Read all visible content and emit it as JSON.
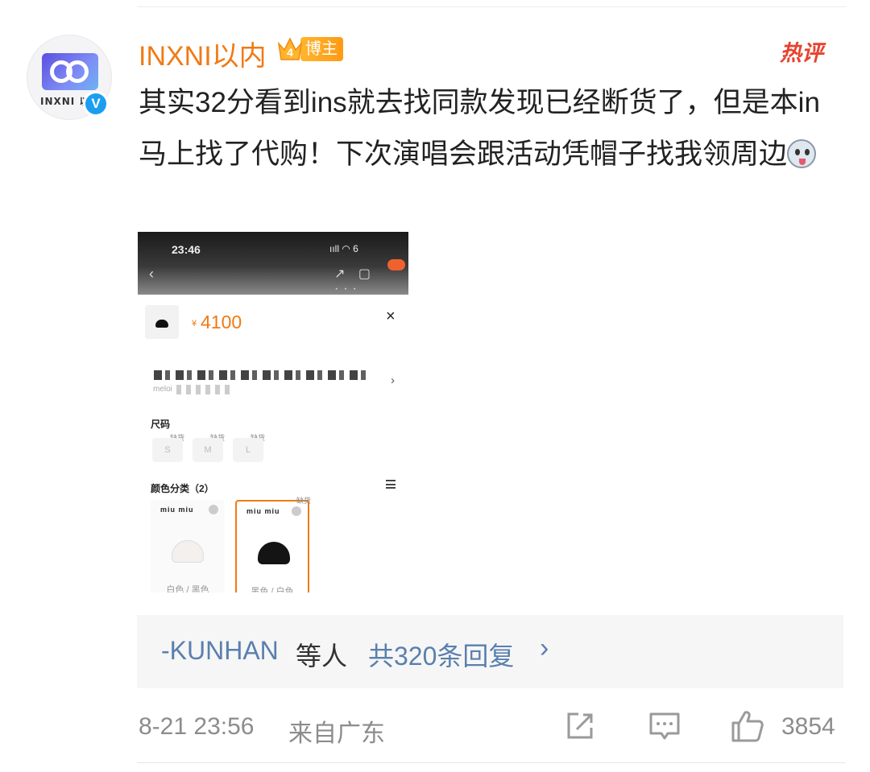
{
  "post": {
    "avatar_text": "INXNI 以",
    "username": "INXNI以内",
    "vip_level": "4",
    "vip_label": "博主",
    "hot_tag": "热评",
    "content": "其实32分看到ins就去找同款发现已经断货了，但是本in马上找了代购！下次演唱会跟活动凭帽子找我领周边",
    "emoji_icon": "husky-dog-emoji-icon"
  },
  "embedded_screenshot": {
    "status_time": "23:46",
    "status_indicators": "ııll ◠ 6",
    "price_prefix": "¥",
    "price": "4100",
    "close_icon": "×",
    "blurred_sub_label": "meloi",
    "size_label": "尺码",
    "sizes": [
      {
        "label": "S",
        "tag": "缺货"
      },
      {
        "label": "M",
        "tag": "缺货"
      },
      {
        "label": "L",
        "tag": "缺货"
      }
    ],
    "color_label": "颜色分类（2）",
    "colors": [
      {
        "brand": "miu miu",
        "name": "白色 / 黑色",
        "tag": ""
      },
      {
        "brand": "miu miu",
        "name": "黑色 / 白色",
        "tag": "缺货"
      }
    ]
  },
  "replies": {
    "user": "-KUNHAN",
    "etc": "等人",
    "count_text": "共320条回复",
    "chevron": "›"
  },
  "footer": {
    "timestamp": "8-21 23:56",
    "location": "来自广东",
    "likes": "3854"
  },
  "colors": {
    "username": "#f07a15",
    "link": "#5a7faf",
    "hot": "#e6432e",
    "meta": "#8c8c8c"
  }
}
